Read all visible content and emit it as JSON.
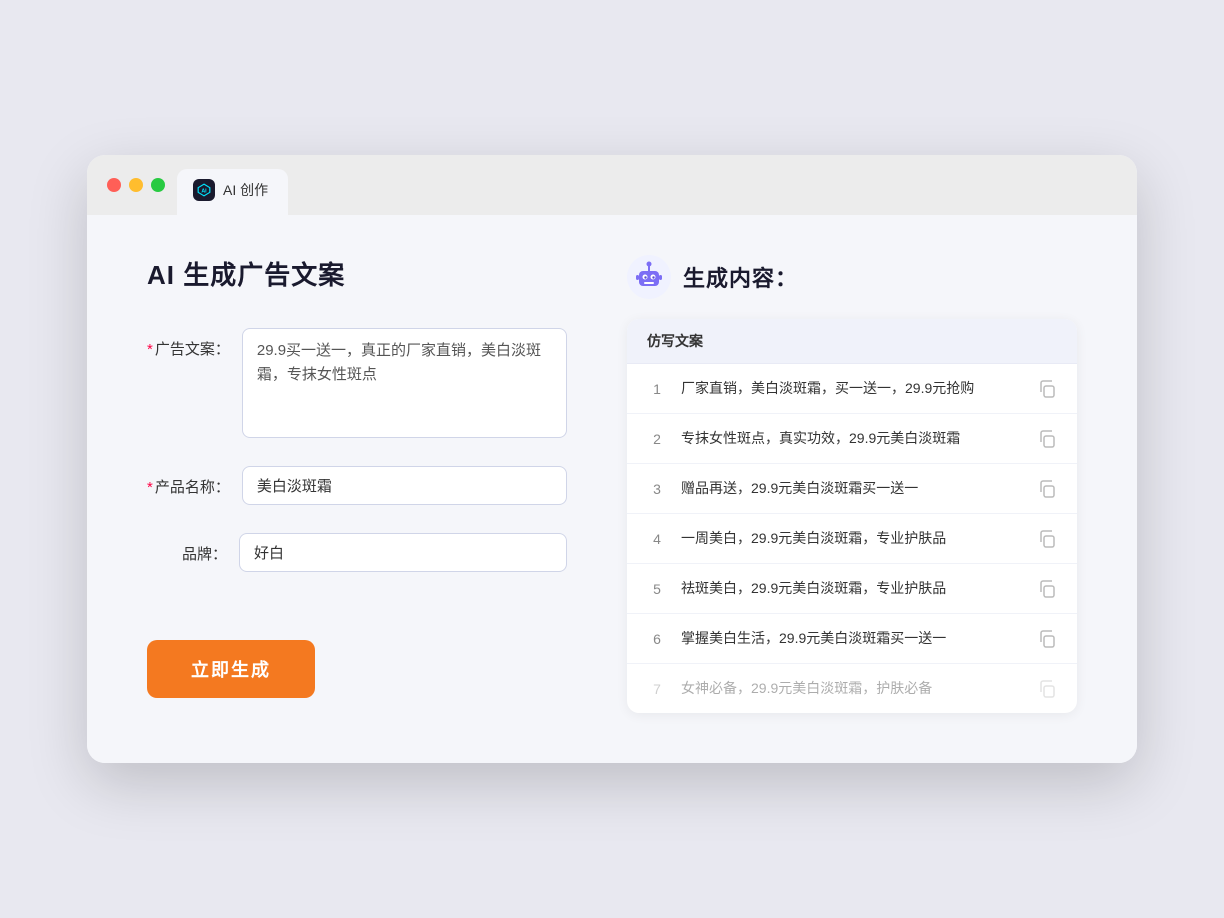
{
  "browser": {
    "tab_label": "AI 创作"
  },
  "page": {
    "title": "AI 生成广告文案",
    "right_title": "生成内容："
  },
  "form": {
    "ad_label": "广告文案：",
    "ad_required": true,
    "ad_value": "29.9买一送一，真正的厂家直销，美白淡斑霜，专抹女性斑点",
    "product_label": "产品名称：",
    "product_required": true,
    "product_value": "美白淡斑霜",
    "brand_label": "品牌：",
    "brand_required": false,
    "brand_value": "好白",
    "generate_btn": "立即生成"
  },
  "results": {
    "column_header": "仿写文案",
    "items": [
      {
        "num": "1",
        "text": "厂家直销，美白淡斑霜，买一送一，29.9元抢购",
        "faded": false
      },
      {
        "num": "2",
        "text": "专抹女性斑点，真实功效，29.9元美白淡斑霜",
        "faded": false
      },
      {
        "num": "3",
        "text": "赠品再送，29.9元美白淡斑霜买一送一",
        "faded": false
      },
      {
        "num": "4",
        "text": "一周美白，29.9元美白淡斑霜，专业护肤品",
        "faded": false
      },
      {
        "num": "5",
        "text": "祛斑美白，29.9元美白淡斑霜，专业护肤品",
        "faded": false
      },
      {
        "num": "6",
        "text": "掌握美白生活，29.9元美白淡斑霜买一送一",
        "faded": false
      },
      {
        "num": "7",
        "text": "女神必备，29.9元美白淡斑霜，护肤必备",
        "faded": true
      }
    ]
  }
}
